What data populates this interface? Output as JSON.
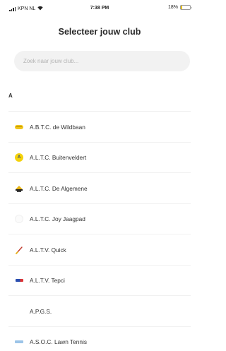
{
  "status_bar": {
    "carrier": "KPN NL",
    "time": "7:38 PM",
    "battery_text": "18%",
    "battery_level": 0.18
  },
  "header": {
    "title": "Selecteer jouw club"
  },
  "search": {
    "placeholder": "Zoek naar jouw club...",
    "value": ""
  },
  "section": {
    "letter": "A"
  },
  "clubs": [
    {
      "name": "A.B.T.C. de Wildbaan",
      "icon": "wildbaan-logo-icon"
    },
    {
      "name": "A.L.T.C. Buitenveldert",
      "icon": "buitenveldert-logo-icon",
      "logo_letter": "A"
    },
    {
      "name": "A.L.T.C. De Algemene",
      "icon": "algemene-logo-icon"
    },
    {
      "name": "A.L.T.C. Joy Jaagpad",
      "icon": "joy-jaagpad-logo-icon"
    },
    {
      "name": "A.L.T.V. Quick",
      "icon": "quick-logo-icon"
    },
    {
      "name": "A.L.T.V. Tepci",
      "icon": "tepci-logo-icon"
    },
    {
      "name": "A.P.G.S.",
      "icon": "apgs-logo-icon"
    },
    {
      "name": "A.S.O.C. Lawn Tennis",
      "icon": "asoc-logo-icon"
    }
  ],
  "colors": {
    "search_bg": "#f2f2f2",
    "battery_fill": "#e6c21e",
    "divider": "#f1f1f1"
  }
}
